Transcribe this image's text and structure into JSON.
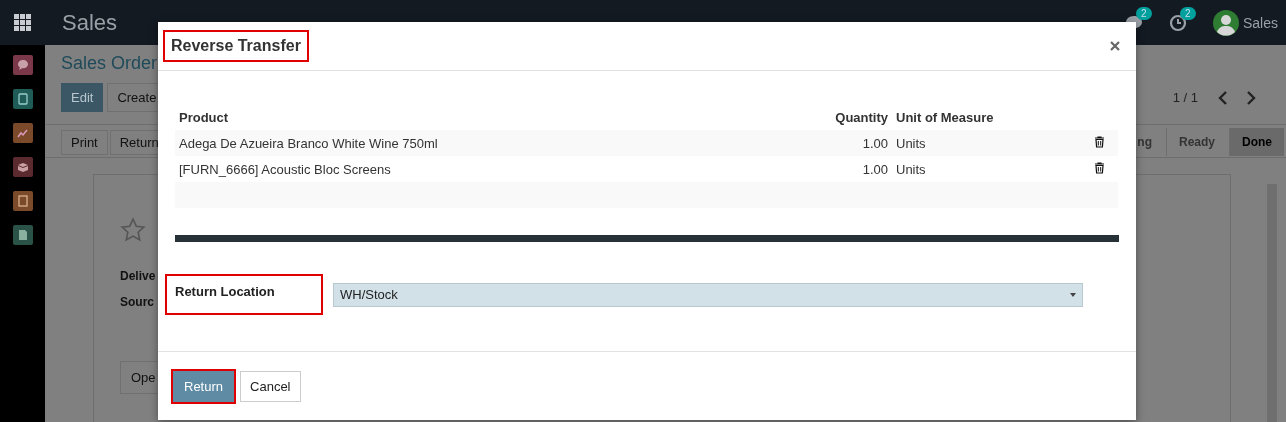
{
  "navbar": {
    "app_title": "Sales",
    "notifications": [
      {
        "kind": "chat",
        "count": "2"
      },
      {
        "kind": "activity",
        "count": "2"
      }
    ],
    "user": "Sales"
  },
  "sidebar_apps": [
    {
      "kind": "chat",
      "color": "#7a3848"
    },
    {
      "kind": "contacts",
      "color": "#1f5c58"
    },
    {
      "kind": "chart",
      "color": "#7a4a2a"
    },
    {
      "kind": "box",
      "color": "#5a2a2e"
    },
    {
      "kind": "invoice",
      "color": "#7a4a2a"
    },
    {
      "kind": "document",
      "color": "#2a5246"
    }
  ],
  "form": {
    "breadcrumb": "Sales Order",
    "buttons": [
      {
        "label": "Edit",
        "primary": true
      },
      {
        "label": "Create",
        "primary": false
      }
    ],
    "pager": "1 / 1",
    "actions": [
      "Print",
      "Return"
    ],
    "statuses": [
      {
        "label": "ng",
        "selected": false
      },
      {
        "label": "Ready",
        "selected": false
      },
      {
        "label": "Done",
        "selected": true
      }
    ],
    "starred": false,
    "field_labels": [
      "Delive",
      "Sourc"
    ],
    "bottom_button": "Ope"
  },
  "dialog": {
    "title": "Reverse Transfer",
    "title_highlighted": true,
    "columns": [
      "Product",
      "Quantity",
      "Unit of Measure"
    ],
    "rows": [
      {
        "product": "Adega De Azueira Branco White Wine 750ml",
        "quantity": "1.00",
        "uom": "Units"
      },
      {
        "product": "[FURN_6666] Acoustic Bloc Screens",
        "quantity": "1.00",
        "uom": "Units"
      }
    ],
    "return_location": {
      "label": "Return Location",
      "highlighted": true,
      "value": "WH/Stock"
    },
    "buttons": [
      {
        "label": "Return",
        "primary": true,
        "highlighted": true
      },
      {
        "label": "Cancel",
        "primary": false,
        "highlighted": false
      }
    ]
  }
}
